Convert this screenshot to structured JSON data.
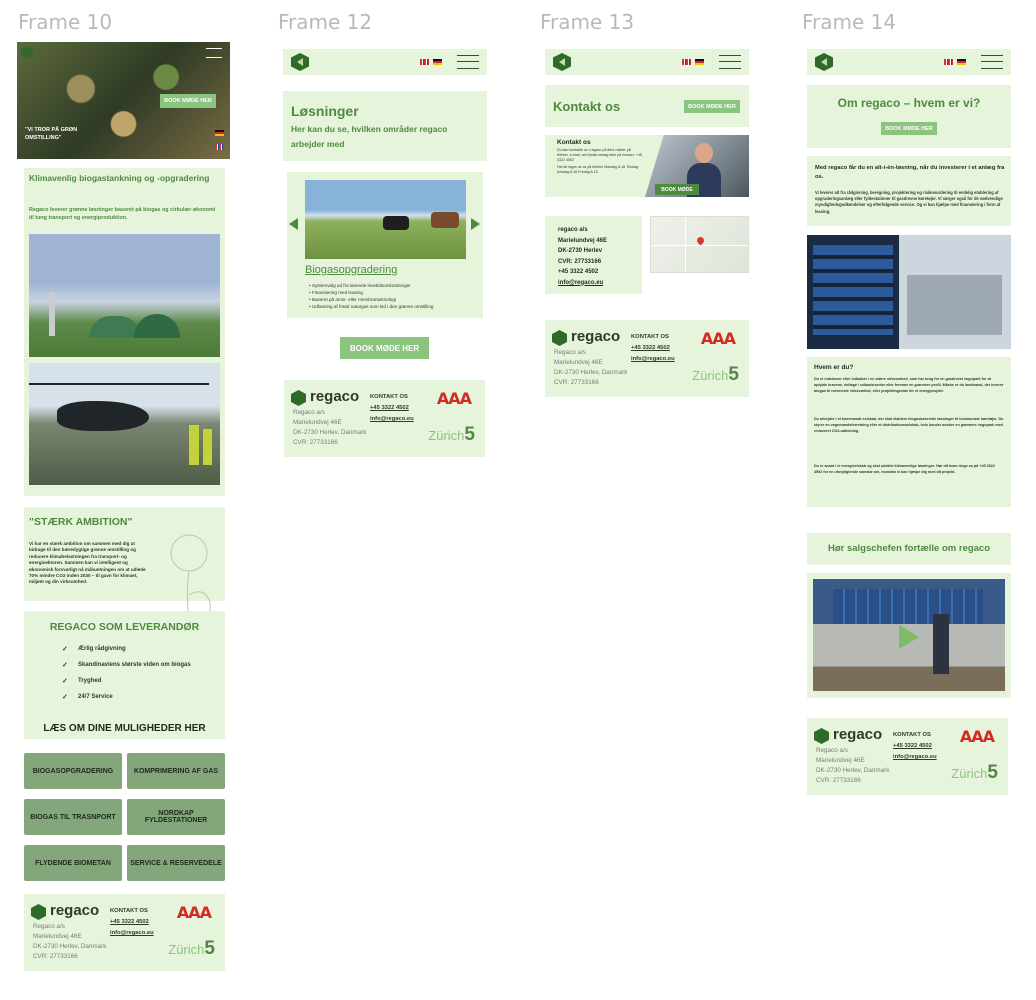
{
  "frames": [
    {
      "label": "Frame 10"
    },
    {
      "label": "Frame 12"
    },
    {
      "label": "Frame 13"
    },
    {
      "label": "Frame 14"
    }
  ],
  "frame10": {
    "hero_button": "BOOK MØDE HER",
    "hero_quote": "\"VI TROR PÅ GRØN OMSTILLING\"",
    "section_title": "Klimavenlig biogastankning og -opgradering",
    "section_text": "Regaco leverer grønne løsninger baseret på biogas og cirkulær økonomi til tung transport og energiproduktion.",
    "ambition_title": "\"STÆRK AMBITION\"",
    "ambition_text": "Vi har en stærk ambition om sammen med dig at bidrage til den bæredygtige grønne omstilling og reducere klimabelastningen fra transport- og energisektoren. Sammen kan vi intelligent og økonomisk forsvarligt nå målsætningen om at udlede 70% mindre CO2 inden 2030 – til gavn for klimaet, miljøet og din virksomhed.",
    "supplier_title": "REGACO SOM LEVERANDØR",
    "supplier_items": [
      "Ærlig rådgivning",
      "Skandinaviens største viden om biogas",
      "Tryghed",
      "24/7 Service"
    ],
    "options_title": "LÆS OM DINE MULIGHEDER HER",
    "options": [
      "BIOGASOPGRADERING",
      "KOMPRIMERING AF GAS",
      "BIOGAS TIL TRASNPORT",
      "NORDKAP FYLDESTATIONER",
      "FLYDENDE BIOMETAN",
      "SERVICE & RESERVEDELE"
    ]
  },
  "frame12": {
    "title": "Løsninger",
    "subtitle": "Her kan du se, hvilken områder regaco arbejder med",
    "slide_title": "Biogasopgradering",
    "slide_bullets": [
      "Systemvalg ud fra løvende levetidsomkostninger",
      "Finansiering med leasing",
      "Baseret på amin- eller membranteknologi",
      "Udfasning af fossil naturgas som led i den grønne omstilling"
    ],
    "book_button": "BOOK MØDE HER"
  },
  "frame13": {
    "title": "Kontakt os",
    "book_button": "BOOK MØDE HER",
    "contact_title": "Kontakt os",
    "contact_text": "Du kan kontakte os i regaco på flere måder på telefon, e-mail, ved fysisk besøg eller på messer. +45 3322 4502",
    "contact_hours": "Hel de tagen at os på telefon Mandag 8-16 Tirsdag-torsdag 8-16 Fredag 8-15",
    "contact_button": "BOOK MØDE",
    "address_lines": [
      "regaco a/s",
      "Marielundvej 46E",
      "DK-2730 Herlev",
      "CVR: 27733166",
      "+45 3322 4502",
      "info@regaco.eu"
    ]
  },
  "frame14": {
    "title": "Om regaco – hvem er vi?",
    "book_button": "BOOK MØDE HER",
    "intro_bold": "Med regaco får du en alt-i-én-løsning, når du investerer i et anlæg fra os.",
    "intro_text": "Vi leverer alt fra rådgivning, beregning, projektering og risikovurdering til endelig etablering af opgraderingsanlæg eller fyldestationer til gasdrevne køretøjer. Vi sørger også for de nødvendige myndighedsgodkendelser og efterfølgende service. Og vi kan hjælpe med finansiering i form af leasing.",
    "who_title": "Hvem er du?",
    "who_p1": "Du er indehaver eller indkøber i en større virksomhed, som har brug for en gasdrevet vognpark for at opfylde kravene, deltage i udbudsrunder eller fremme en grønnere profil. Måske er du landmand, der leverer biogas til nærmeste virksomhed, eller projektingeniør for et energiprojekt.",
    "who_p2": "Du arbejder i et kommunalt selskab, der skal etablere biogasbaserede løsninger til kommunale køretøjer. Du styrer en vognmandsforretning eller et distributionsselskab, hvis kunder ønsker en grønnere vognpark med reduceret CO2-udledning.",
    "who_p3": "Du er ansat i et energiselskab og skal udvikle klimavenlige løsninger. Hør dit team ringe os på +45 3322 4502 for en uforpligtende samtale om, hvordan vi kan hjælpe dig med dit projekt.",
    "sales_title": "Hør salgschefen fortælle om regaco"
  },
  "footer": {
    "brand": "regaco",
    "address": [
      "Regaco a/s",
      "Marielundvej 46E",
      "DK-2730 Herlev, Danmark",
      "CVR: 27733166"
    ],
    "contact_label": "KONTAKT OS",
    "phone": "+45 3322 4502",
    "email": "info@regaco.eu",
    "rating": "AAA",
    "zurich_word": "Zürich",
    "zurich_num": "5"
  },
  "colors": {
    "panel": "#e7f4dc",
    "accent_green": "#4e8a3f",
    "button_green": "#8bc47e",
    "grid_button": "#84a67b"
  }
}
